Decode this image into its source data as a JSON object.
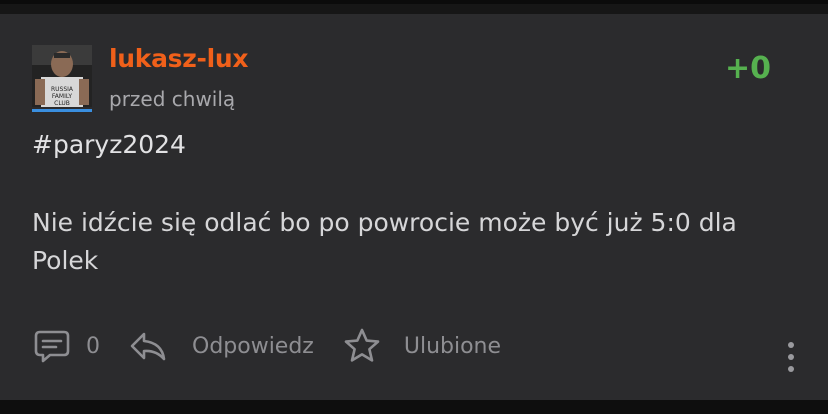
{
  "post": {
    "author": "lukasz-lux",
    "timestamp": "przed chwilą",
    "score": "+0",
    "tag": "#paryz2024",
    "body": "Nie idźcie się odlać bo po powrocie może być już 5:0 dla Polek",
    "avatar_text": "RUSSIA FAMILY CLUB"
  },
  "actions": {
    "comments_icon": "comment-icon",
    "comments_count": "0",
    "reply_icon": "reply-icon",
    "reply_label": "Odpowiedz",
    "favorite_icon": "star-icon",
    "favorite_label": "Ulubione",
    "more_icon": "more-vertical-icon"
  },
  "colors": {
    "username": "#f0601a",
    "score": "#56b14f",
    "card_background": "#2b2b2d",
    "page_background": "#161616",
    "avatar_underline": "#3a8fe0"
  }
}
